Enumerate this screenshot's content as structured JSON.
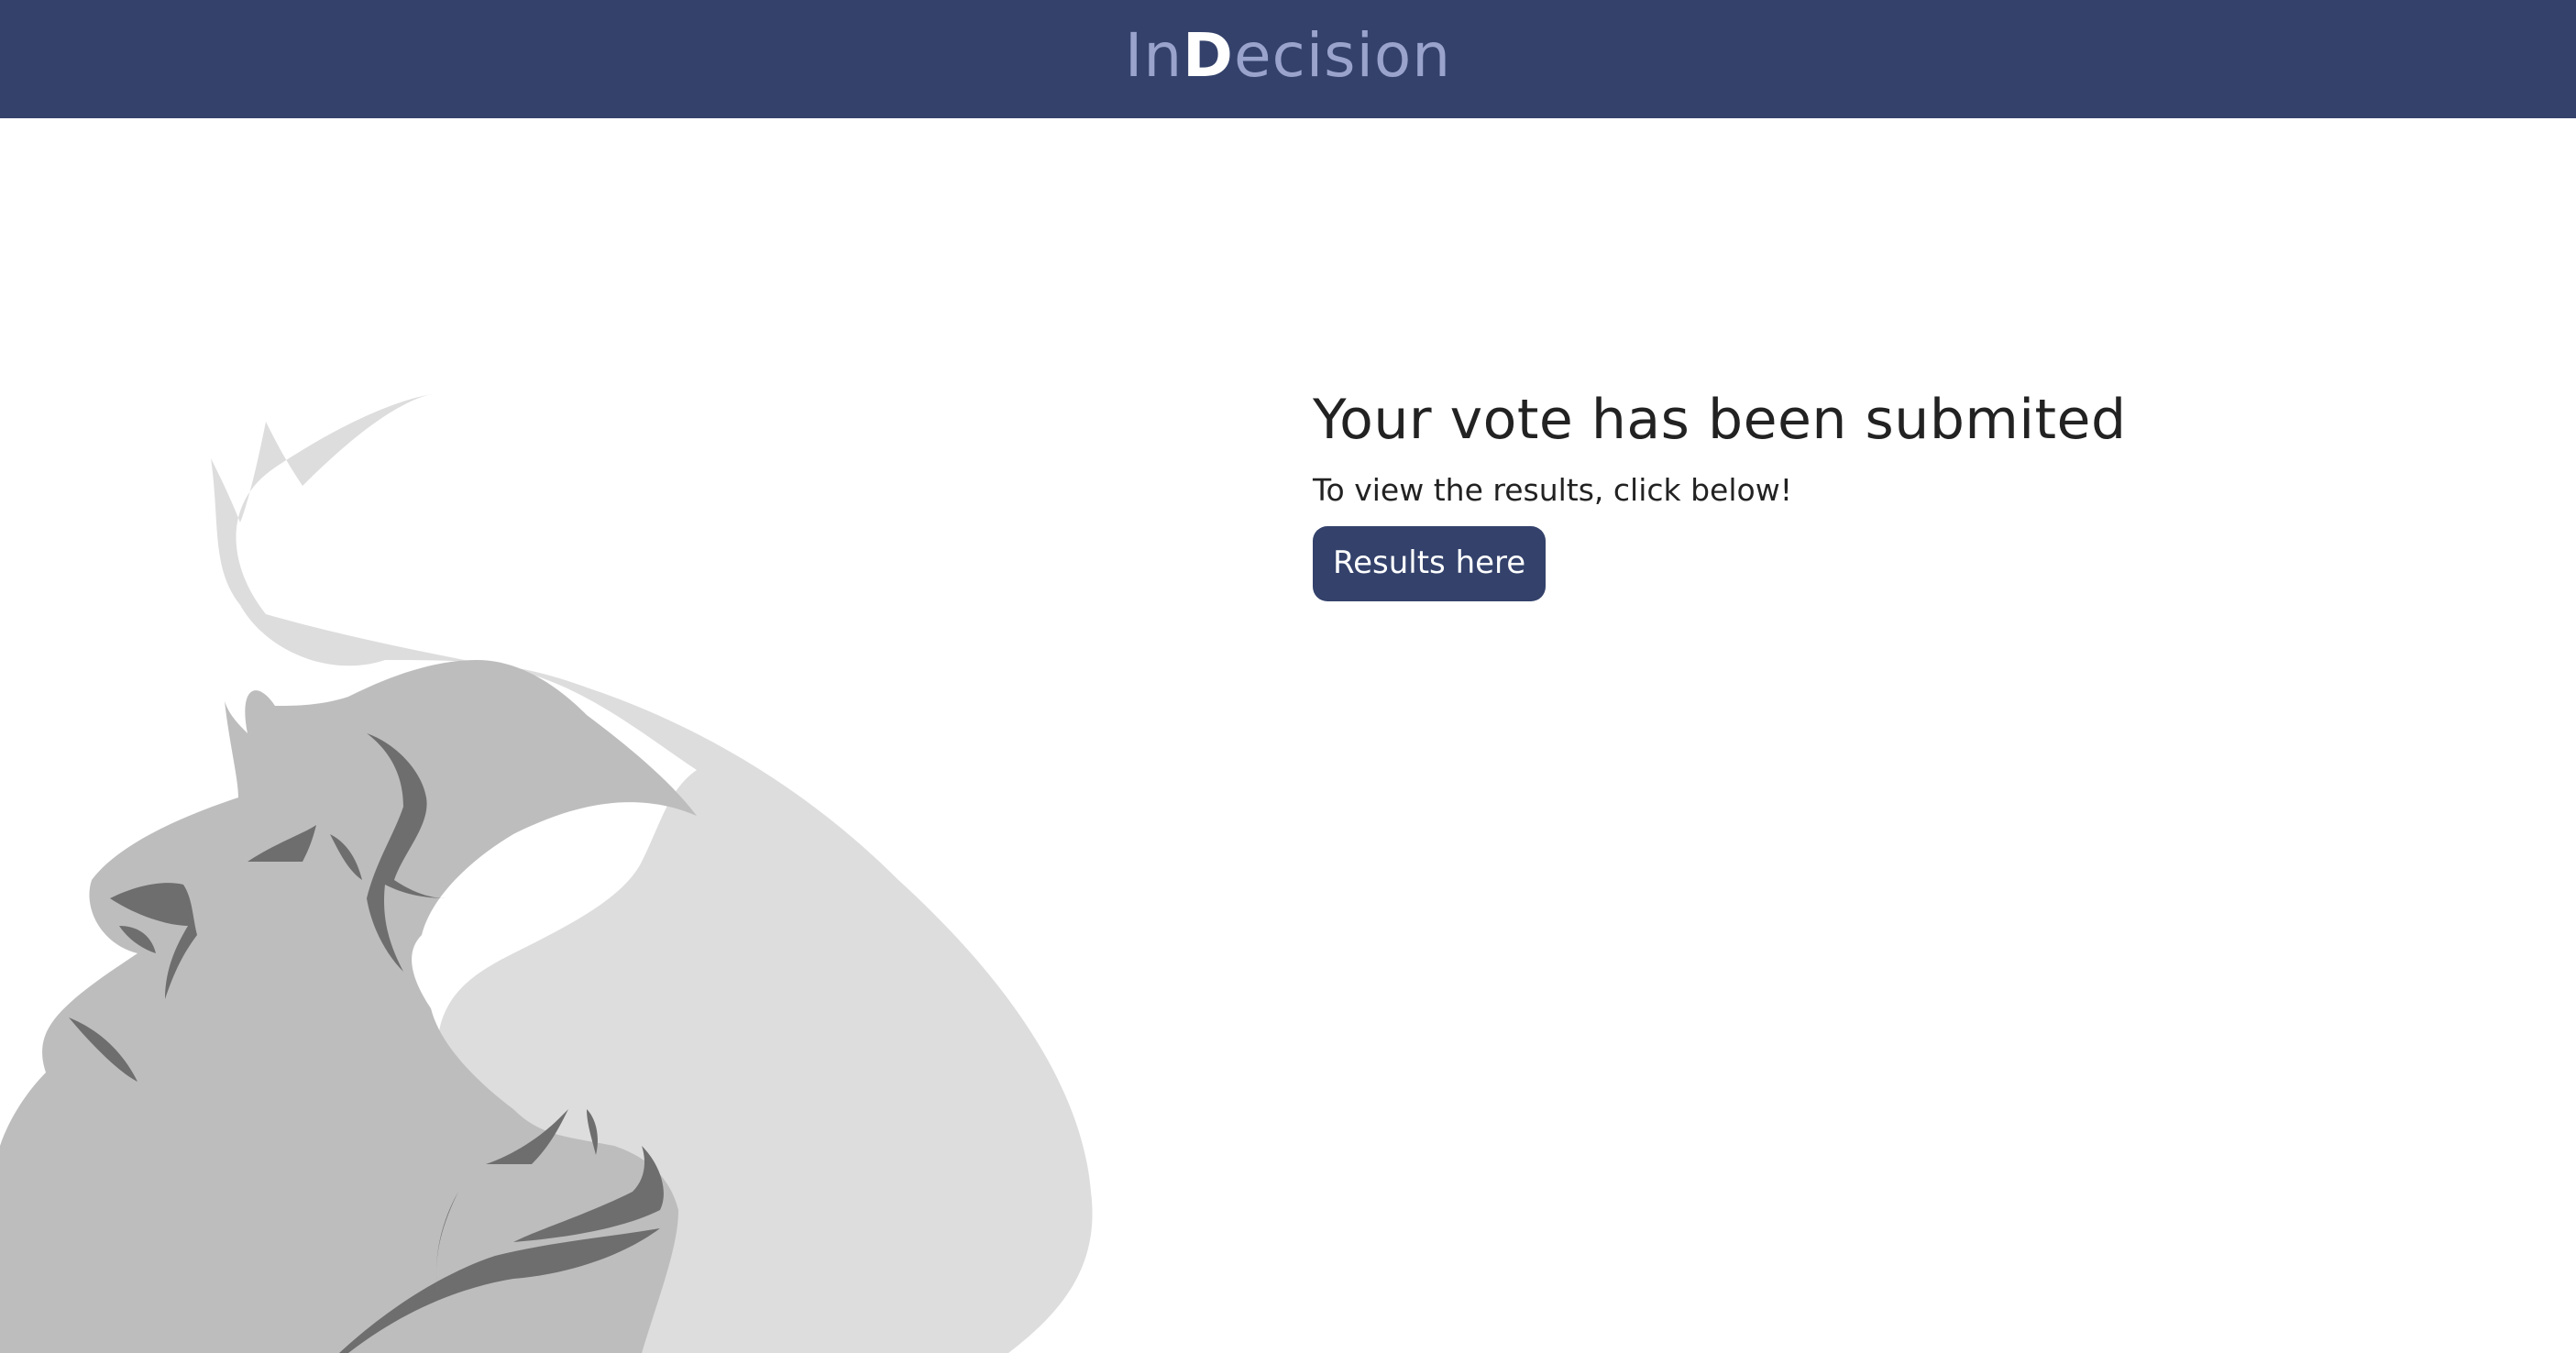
{
  "header": {
    "logo_prefix": "In",
    "logo_accent": "D",
    "logo_suffix": "ecision",
    "background_color": "#33416b"
  },
  "illustration": {
    "name": "face-silhouette-illustration"
  },
  "main": {
    "title": "Your vote has been submited",
    "subtitle": "To view the results, click below!",
    "button_label": "Results here"
  }
}
